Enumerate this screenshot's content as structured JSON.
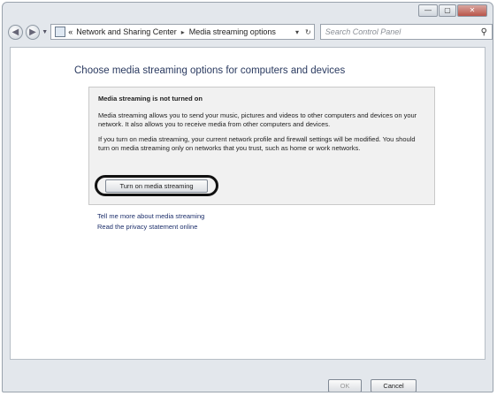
{
  "window": {
    "caption_min": "—",
    "caption_max": "▢",
    "caption_close": "✕"
  },
  "nav": {
    "back_glyph": "◀",
    "forward_glyph": "▶",
    "history_dropdown": "▼",
    "address_menu_glyph": "«",
    "breadcrumb": [
      "Network and Sharing Center",
      "Media streaming options"
    ],
    "breadcrumb_sep": "▸",
    "address_dropdown": "▾",
    "refresh_glyph": "↻",
    "search_placeholder": "Search Control Panel",
    "search_glyph": "⚲"
  },
  "page": {
    "title": "Choose media streaming options for computers and devices",
    "info": {
      "heading": "Media streaming is not turned on",
      "para1": "Media streaming allows you to send your music, pictures and videos to other computers and devices on your network. It also allows you to receive media from other computers and devices.",
      "para2": "If you turn on media streaming, your current network profile and firewall settings will be modified. You should turn on media streaming only on networks that you trust, such as home or work networks.",
      "button_label": "Turn on media streaming"
    },
    "links": [
      "Tell me more about media streaming",
      "Read the privacy statement online"
    ]
  },
  "footer": {
    "ok_label": "OK",
    "cancel_label": "Cancel"
  }
}
